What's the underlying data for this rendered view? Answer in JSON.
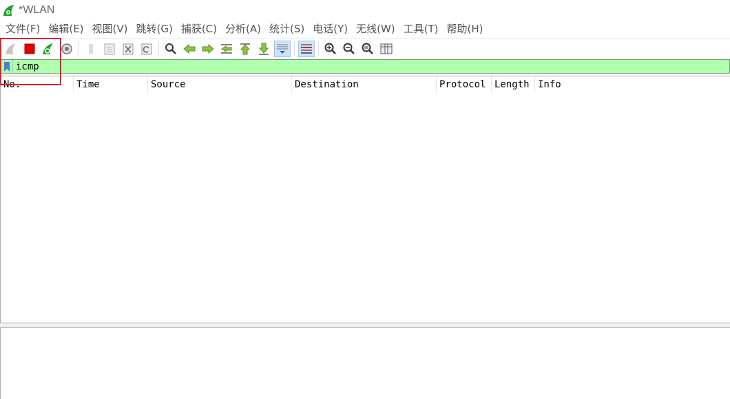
{
  "window": {
    "title": "*WLAN"
  },
  "menu": [
    "文件(F)",
    "编辑(E)",
    "视图(V)",
    "跳转(G)",
    "捕获(C)",
    "分析(A)",
    "统计(S)",
    "电话(Y)",
    "无线(W)",
    "工具(T)",
    "帮助(H)"
  ],
  "toolbar": {
    "icons": [
      "start-capture-icon",
      "stop-capture-icon",
      "restart-capture-icon",
      "capture-options-icon",
      "open-file-icon",
      "save-file-icon",
      "close-file-icon",
      "reload-file-icon",
      "find-packet-icon",
      "go-back-icon",
      "go-forward-icon",
      "go-to-packet-icon",
      "go-first-icon",
      "go-last-icon",
      "autoscroll-icon",
      "colorize-icon",
      "zoom-in-icon",
      "zoom-out-icon",
      "normal-size-icon",
      "resize-columns-icon"
    ]
  },
  "filter": {
    "value": "icmp"
  },
  "packet_list": {
    "columns": [
      "No.",
      "Time",
      "Source",
      "Destination",
      "Protocol",
      "Length",
      "Info"
    ],
    "rows": []
  },
  "colors": {
    "filter_valid_bg": "#afffaf",
    "annotation_red": "#e0202a",
    "stop_red": "#e00000"
  }
}
